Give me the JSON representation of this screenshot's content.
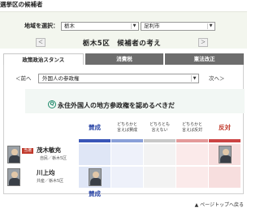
{
  "header": {
    "title": "選挙区の候補者"
  },
  "area_select": {
    "label": "地域を選択：",
    "prefecture": "栃木",
    "city": "足利市"
  },
  "district_nav": {
    "prev": "＜",
    "next": "＞",
    "title": "栃木5区　候補者の考え"
  },
  "tabs": [
    {
      "label": "政策政治スタンス",
      "active": true
    },
    {
      "label": "消費税",
      "active": false
    },
    {
      "label": "憲法改正",
      "active": false
    }
  ],
  "issue_nav": {
    "prev": "＜前へ",
    "selected": "外国人の参政権",
    "next": "次へ＞"
  },
  "question": {
    "icon": "Q",
    "text": "永住外国人の地方参政権を認めるべきだ"
  },
  "scale": {
    "columns": [
      {
        "label": "賛成",
        "big": true,
        "color": "#2f4aa8",
        "band": "#3a56b8",
        "fill": "#dfe6f6"
      },
      {
        "label": "どちらかと\n言えば賛成",
        "big": false,
        "color": "#333333",
        "band": "#8aa0d8",
        "fill": "#eef1fa"
      },
      {
        "label": "どちらとも\n言えない",
        "big": false,
        "color": "#333333",
        "band": "#c8c8c8",
        "fill": "#f3f3f3"
      },
      {
        "label": "どちらかと\n言えば反対",
        "big": false,
        "color": "#333333",
        "band": "#e49a9a",
        "fill": "#fbeaea"
      },
      {
        "label": "反対",
        "big": true,
        "color": "#c0392b",
        "band": "#cc4444",
        "fill": "#f7dede"
      }
    ],
    "footer_label": "賛成"
  },
  "candidates": [
    {
      "badge": "当選",
      "name": "茂木敏充",
      "party": "自民／栃木5区",
      "answer_column": 4
    },
    {
      "badge": "",
      "name": "川上均",
      "party": "共産／栃木5区",
      "answer_column": 0
    }
  ],
  "footer": {
    "page_top": "▲ ページトップへ戻る"
  }
}
